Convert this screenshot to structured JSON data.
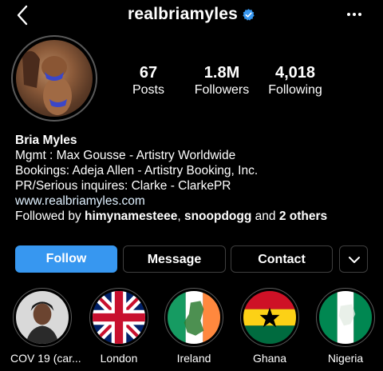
{
  "header": {
    "username": "realbriamyles",
    "verified_icon": "verified-badge-icon",
    "back_icon": "chevron-left-icon",
    "more_icon": "more-horizontal-icon"
  },
  "stats": [
    {
      "value": "67",
      "label": "Posts"
    },
    {
      "value": "1.8M",
      "label": "Followers"
    },
    {
      "value": "4,018",
      "label": "Following"
    }
  ],
  "bio": {
    "name": "Bria Myles",
    "lines": [
      "Mgmt : Max Gousse - Artistry Worldwide",
      "Bookings: Adeja Allen - Artistry Booking, Inc.",
      "PR/Serious inquires: Clarke - ClarkePR"
    ],
    "link": "www.realbriamyles.com",
    "followed_by": {
      "prefix": "Followed by ",
      "user1": "himynamesteee",
      "sep": ", ",
      "user2": "snoopdogg",
      "and": " and ",
      "others": "2 others"
    }
  },
  "buttons": {
    "follow": "Follow",
    "message": "Message",
    "contact": "Contact",
    "suggest_icon": "chevron-down-icon"
  },
  "highlights": [
    {
      "label": "COV 19 (car..."
    },
    {
      "label": "London"
    },
    {
      "label": "Ireland"
    },
    {
      "label": "Ghana"
    },
    {
      "label": "Nigeria"
    }
  ],
  "colors": {
    "accent": "#3797f0",
    "background": "#000000",
    "button_border": "#3f3f3f"
  }
}
